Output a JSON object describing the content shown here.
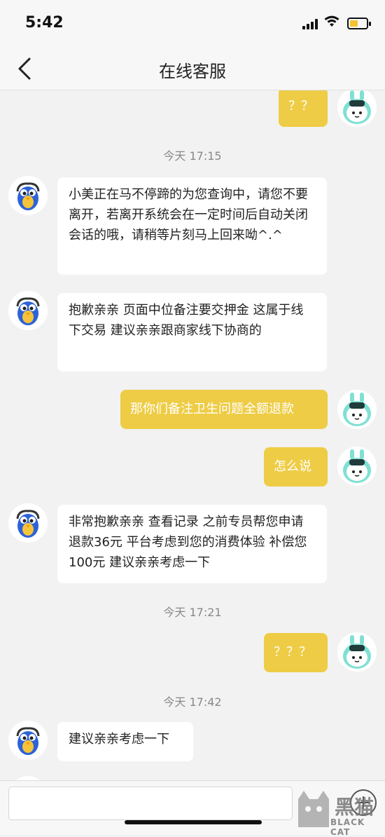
{
  "status_bar": {
    "time": "5:42"
  },
  "nav": {
    "title": "在线客服"
  },
  "messages": [
    {
      "side": "right",
      "text": "？？"
    },
    {
      "type": "time",
      "text": "今天 17:15"
    },
    {
      "side": "left",
      "text": "小美正在马不停蹄的为您查询中，请您不要离开，若离开系统会在一定时间后自动关闭会话的哦，请稍等片刻马上回来呦^.^"
    },
    {
      "side": "left",
      "text": "抱歉亲亲 页面中位备注要交押金 这属于线下交易 建议亲亲跟商家线下协商的"
    },
    {
      "side": "right",
      "text": "那你们备注卫生问题全额退款"
    },
    {
      "side": "right",
      "text": "怎么说"
    },
    {
      "side": "left",
      "text": "非常抱歉亲亲 查看记录 之前专员帮您申请退款36元 平台考虑到您的消费体验 补偿您100元 建议亲亲考虑一下"
    },
    {
      "type": "time",
      "text": "今天 17:21"
    },
    {
      "side": "right",
      "text": "？？？"
    },
    {
      "type": "time",
      "text": "今天 17:42"
    },
    {
      "side": "left",
      "text": "建议亲亲考虑一下"
    }
  ],
  "watermark": {
    "main": "黑猫",
    "sub": "BLACK CAT"
  },
  "colors": {
    "accent": "#eecc45",
    "bg": "#f2f2f2"
  }
}
